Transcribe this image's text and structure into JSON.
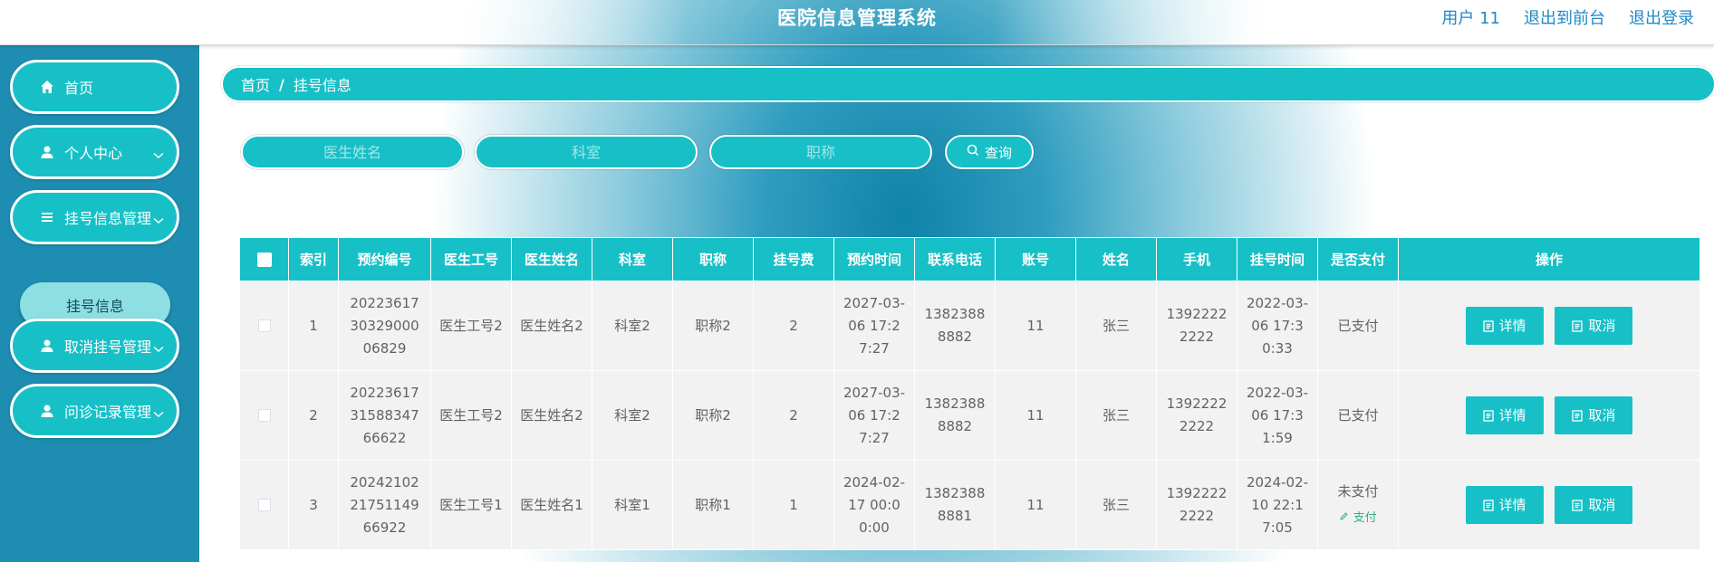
{
  "header": {
    "title": "医院信息管理系统",
    "user_label": "用户 11",
    "front_link": "退出到前台",
    "logout_link": "退出登录"
  },
  "sidebar": {
    "items": [
      {
        "label": "首页",
        "icon": "home-icon"
      },
      {
        "label": "个人中心",
        "icon": "user-icon"
      },
      {
        "label": "挂号信息管理",
        "icon": "list-icon"
      },
      {
        "label": "取消挂号管理",
        "icon": "user-icon"
      },
      {
        "label": "问诊记录管理",
        "icon": "user-icon"
      }
    ],
    "sub_item": "挂号信息"
  },
  "breadcrumb": {
    "home": "首页",
    "separator": "/",
    "current": "挂号信息"
  },
  "search": {
    "doctor_name_placeholder": "医生姓名",
    "department_placeholder": "科室",
    "title_placeholder": "职称",
    "button_label": "查询"
  },
  "table": {
    "headers": [
      "索引",
      "预约编号",
      "医生工号",
      "医生姓名",
      "科室",
      "职称",
      "挂号费",
      "预约时间",
      "联系电话",
      "账号",
      "姓名",
      "手机",
      "挂号时间",
      "是否支付",
      "操作"
    ],
    "rows": [
      {
        "index": "1",
        "booking_no": "202236173032900006829",
        "doctor_id": "医生工号2",
        "doctor_name": "医生姓名2",
        "dept": "科室2",
        "title": "职称2",
        "fee": "2",
        "appt_time": "2027-03-06 17:27:27",
        "contact": "13823888882",
        "account": "11",
        "name": "张三",
        "mobile": "13922222222",
        "reg_time": "2022-03-06 17:30:33",
        "paid": "已支付",
        "pay_link": ""
      },
      {
        "index": "2",
        "booking_no": "202236173158834766622",
        "doctor_id": "医生工号2",
        "doctor_name": "医生姓名2",
        "dept": "科室2",
        "title": "职称2",
        "fee": "2",
        "appt_time": "2027-03-06 17:27:27",
        "contact": "13823888882",
        "account": "11",
        "name": "张三",
        "mobile": "13922222222",
        "reg_time": "2022-03-06 17:31:59",
        "paid": "已支付",
        "pay_link": ""
      },
      {
        "index": "3",
        "booking_no": "202421022175114966922",
        "doctor_id": "医生工号1",
        "doctor_name": "医生姓名1",
        "dept": "科室1",
        "title": "职称1",
        "fee": "1",
        "appt_time": "2024-02-17 00:00:00",
        "contact": "13823888881",
        "account": "11",
        "name": "张三",
        "mobile": "13922222222",
        "reg_time": "2024-02-10 22:17:05",
        "paid": "未支付",
        "pay_link": "支付"
      }
    ],
    "detail_label": "详情",
    "cancel_label": "取消"
  },
  "colors": {
    "accent": "#17c0c7",
    "sidebar": "#1e8db2",
    "header_link": "#1e88c8",
    "pay_link": "#2ab27b"
  }
}
